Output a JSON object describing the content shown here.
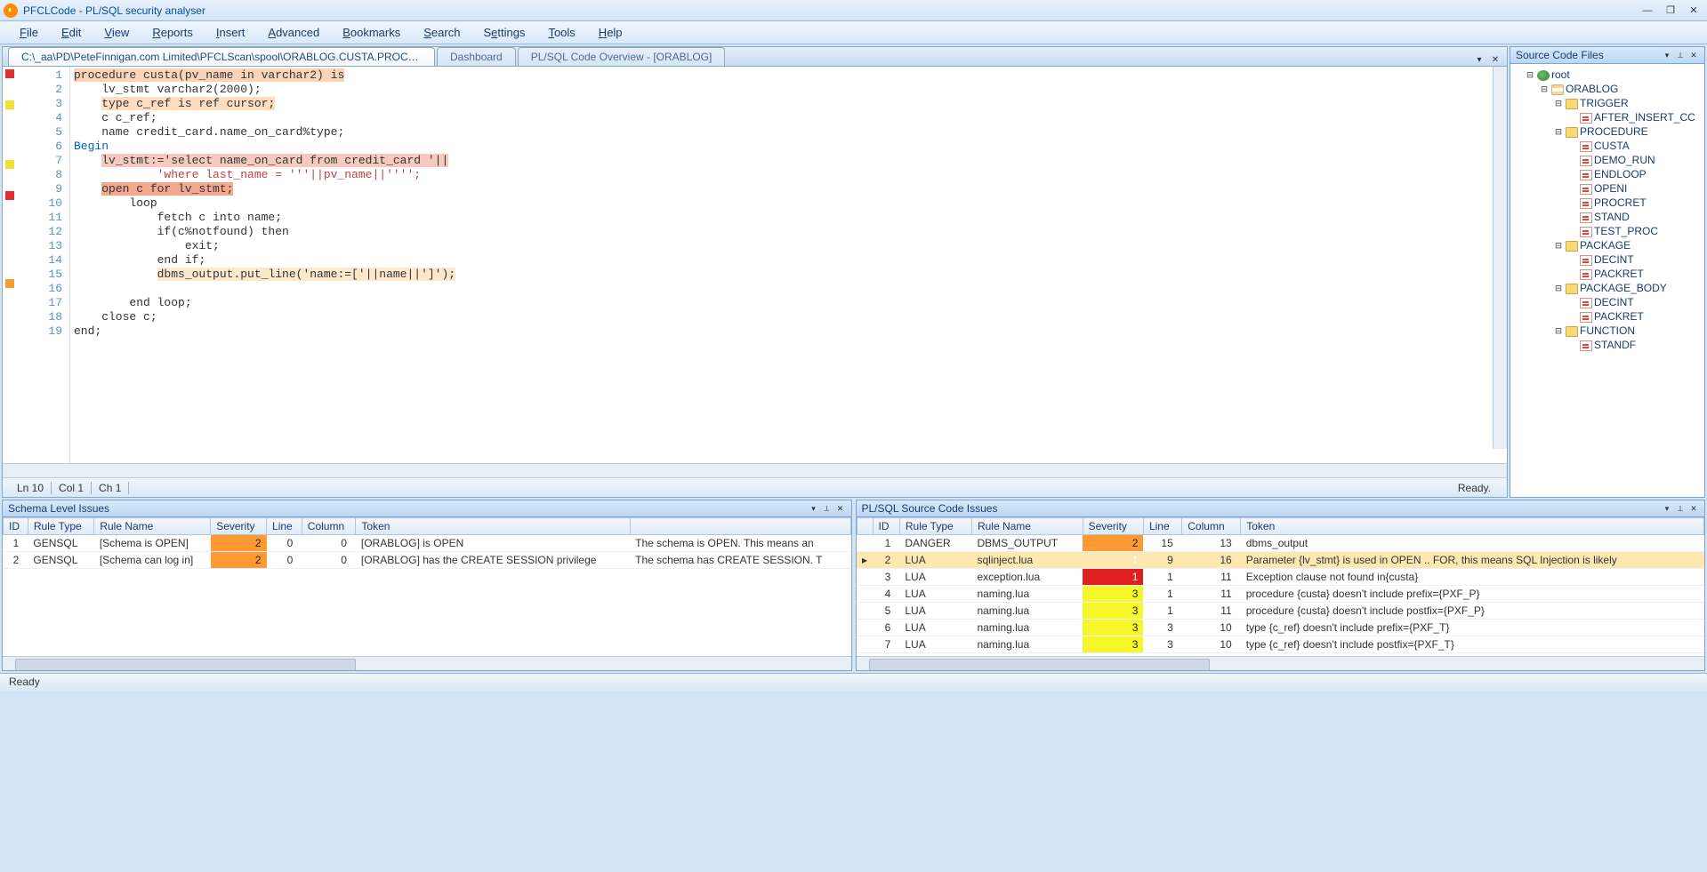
{
  "title": "PFCLCode - PL/SQL security analyser",
  "menu": [
    "File",
    "Edit",
    "View",
    "Reports",
    "Insert",
    "Advanced",
    "Bookmarks",
    "Search",
    "Settings",
    "Tools",
    "Help"
  ],
  "menu_accel_idx": [
    0,
    0,
    0,
    0,
    0,
    0,
    0,
    0,
    1,
    0,
    0
  ],
  "tabs": [
    {
      "label": "C:\\_aa\\PD\\PeteFinnigan.com Limited\\PFCLScan\\spool\\ORABLOG.CUSTA.PROCEDURE",
      "active": true
    },
    {
      "label": "Dashboard",
      "active": false
    },
    {
      "label": "PL/SQL Code Overview - [ORABLOG]",
      "active": false
    }
  ],
  "code": {
    "markers": [
      "red",
      "",
      "yellow",
      "",
      "",
      "",
      "yellow",
      "",
      "red",
      "",
      "",
      "",
      "",
      "",
      "orange",
      "",
      "",
      "",
      "",
      ""
    ],
    "lines": [
      {
        "t": "procedure custa(pv_name in varchar2) is",
        "pre": "",
        "hl": "hl-or2"
      },
      {
        "t": "lv_stmt varchar2(2000);",
        "pre": "    ",
        "hl": ""
      },
      {
        "t": "type c_ref is ref cursor;",
        "pre": "    ",
        "hl": "hl-orange"
      },
      {
        "t": "c c_ref;",
        "pre": "    ",
        "hl": ""
      },
      {
        "t": "name credit_card.name_on_card%type;",
        "pre": "    ",
        "hl": ""
      },
      {
        "t": "Begin",
        "pre": "",
        "hl": "",
        "kw": true
      },
      {
        "t": "lv_stmt:='select name_on_card from credit_card '||",
        "pre": "    ",
        "hl": "hl-red"
      },
      {
        "t": "'where last_name = '''||pv_name||'''';",
        "pre": "            ",
        "hl": "",
        "str": true
      },
      {
        "t": "open c for lv_stmt;",
        "pre": "    ",
        "hl": "hl-redder"
      },
      {
        "t": "loop",
        "pre": "        ",
        "hl": ""
      },
      {
        "t": "fetch c into name;",
        "pre": "            ",
        "hl": ""
      },
      {
        "t": "if(c%notfound) then",
        "pre": "            ",
        "hl": ""
      },
      {
        "t": "exit;",
        "pre": "                ",
        "hl": ""
      },
      {
        "t": "end if;",
        "pre": "            ",
        "hl": ""
      },
      {
        "t": "dbms_output.put_line('name:=['||name||']');",
        "pre": "            ",
        "hl": "hl-yellow"
      },
      {
        "t": "",
        "pre": "",
        "hl": ""
      },
      {
        "t": "end loop;",
        "pre": "        ",
        "hl": ""
      },
      {
        "t": "close c;",
        "pre": "    ",
        "hl": ""
      },
      {
        "t": "end;",
        "pre": "",
        "hl": ""
      }
    ]
  },
  "editor_status": {
    "ln": "Ln 10",
    "col": "Col 1",
    "ch": "Ch 1",
    "ready": "Ready."
  },
  "tree_panel_title": "Source Code Files",
  "tree": [
    {
      "lvl": 1,
      "toggle": "−",
      "icon": "ic-root",
      "label": "root"
    },
    {
      "lvl": 2,
      "toggle": "−",
      "icon": "ic-db",
      "label": "ORABLOG"
    },
    {
      "lvl": 3,
      "toggle": "−",
      "icon": "ic-folder",
      "label": "TRIGGER"
    },
    {
      "lvl": 4,
      "toggle": "",
      "icon": "ic-proc",
      "label": "AFTER_INSERT_CC"
    },
    {
      "lvl": 3,
      "toggle": "−",
      "icon": "ic-folder",
      "label": "PROCEDURE"
    },
    {
      "lvl": 4,
      "toggle": "",
      "icon": "ic-proc",
      "label": "CUSTA"
    },
    {
      "lvl": 4,
      "toggle": "",
      "icon": "ic-proc",
      "label": "DEMO_RUN"
    },
    {
      "lvl": 4,
      "toggle": "",
      "icon": "ic-proc",
      "label": "ENDLOOP"
    },
    {
      "lvl": 4,
      "toggle": "",
      "icon": "ic-proc",
      "label": "OPENI"
    },
    {
      "lvl": 4,
      "toggle": "",
      "icon": "ic-proc",
      "label": "PROCRET"
    },
    {
      "lvl": 4,
      "toggle": "",
      "icon": "ic-proc",
      "label": "STAND"
    },
    {
      "lvl": 4,
      "toggle": "",
      "icon": "ic-proc",
      "label": "TEST_PROC"
    },
    {
      "lvl": 3,
      "toggle": "−",
      "icon": "ic-folder",
      "label": "PACKAGE"
    },
    {
      "lvl": 4,
      "toggle": "",
      "icon": "ic-proc",
      "label": "DECINT"
    },
    {
      "lvl": 4,
      "toggle": "",
      "icon": "ic-proc",
      "label": "PACKRET"
    },
    {
      "lvl": 3,
      "toggle": "−",
      "icon": "ic-folder",
      "label": "PACKAGE_BODY"
    },
    {
      "lvl": 4,
      "toggle": "",
      "icon": "ic-proc",
      "label": "DECINT"
    },
    {
      "lvl": 4,
      "toggle": "",
      "icon": "ic-proc",
      "label": "PACKRET"
    },
    {
      "lvl": 3,
      "toggle": "−",
      "icon": "ic-folder",
      "label": "FUNCTION"
    },
    {
      "lvl": 4,
      "toggle": "",
      "icon": "ic-proc",
      "label": "STANDF"
    }
  ],
  "schema_panel": {
    "title": "Schema Level Issues",
    "headers": [
      "ID",
      "Rule Type",
      "Rule Name",
      "Severity",
      "Line",
      "Column",
      "Token",
      ""
    ],
    "rows": [
      {
        "id": 1,
        "type": "GENSQL",
        "name": "[Schema is OPEN]",
        "sev": 2,
        "line": 0,
        "col": 0,
        "token": "[ORABLOG] is OPEN",
        "desc": "The schema is OPEN. This means an"
      },
      {
        "id": 2,
        "type": "GENSQL",
        "name": "[Schema can log in]",
        "sev": 2,
        "line": 0,
        "col": 0,
        "token": "[ORABLOG] has the CREATE SESSION privilege",
        "desc": "The schema has CREATE SESSION. T"
      }
    ]
  },
  "code_panel": {
    "title": "PL/SQL Source Code Issues",
    "headers": [
      "",
      "ID",
      "Rule Type",
      "Rule Name",
      "Severity",
      "Line",
      "Column",
      "Token"
    ],
    "rows": [
      {
        "sel": false,
        "id": 1,
        "type": "DANGER",
        "name": "DBMS_OUTPUT",
        "sev": 2,
        "line": 15,
        "col": 13,
        "token": "dbms_output"
      },
      {
        "sel": true,
        "id": 2,
        "type": "LUA",
        "name": "sqlinject.lua",
        "sev": 1,
        "line": 9,
        "col": 16,
        "token": "Parameter {lv_stmt} is used in OPEN .. FOR, this means SQL Injection is likely"
      },
      {
        "sel": false,
        "id": 3,
        "type": "LUA",
        "name": "exception.lua",
        "sev": 1,
        "line": 1,
        "col": 11,
        "token": "Exception clause not found in{custa}"
      },
      {
        "sel": false,
        "id": 4,
        "type": "LUA",
        "name": "naming.lua",
        "sev": 3,
        "line": 1,
        "col": 11,
        "token": "procedure {custa} doesn't include prefix={PXF_P}"
      },
      {
        "sel": false,
        "id": 5,
        "type": "LUA",
        "name": "naming.lua",
        "sev": 3,
        "line": 1,
        "col": 11,
        "token": "procedure {custa} doesn't include postfix={PXF_P}"
      },
      {
        "sel": false,
        "id": 6,
        "type": "LUA",
        "name": "naming.lua",
        "sev": 3,
        "line": 3,
        "col": 10,
        "token": "type {c_ref} doesn't include prefix={PXF_T}"
      },
      {
        "sel": false,
        "id": 7,
        "type": "LUA",
        "name": "naming.lua",
        "sev": 3,
        "line": 3,
        "col": 10,
        "token": "type {c_ref} doesn't include postfix={PXF_T}"
      }
    ]
  },
  "status_bar": "Ready"
}
